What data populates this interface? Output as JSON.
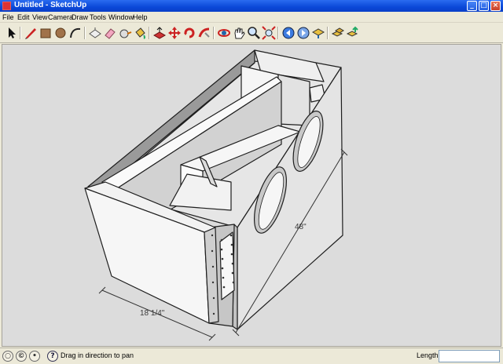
{
  "window": {
    "title": "Untitled - SketchUp",
    "minimize_glyph": "_",
    "maximize_glyph": "□",
    "close_glyph": "×"
  },
  "menu": [
    "File",
    "Edit",
    "View",
    "Camera",
    "Draw",
    "Tools",
    "Window",
    "Help"
  ],
  "toolbar": {
    "tools": [
      {
        "name": "select-tool"
      },
      {
        "name": "pencil-line-tool"
      },
      {
        "name": "rectangle-tool"
      },
      {
        "name": "circle-tool"
      },
      {
        "name": "arc-tool"
      },
      {
        "name": "make-component-tool"
      },
      {
        "name": "eraser-tool"
      },
      {
        "name": "tape-measure-tool"
      },
      {
        "name": "paint-bucket-tool"
      },
      {
        "name": "push-pull-tool"
      },
      {
        "name": "move-tool"
      },
      {
        "name": "rotate-tool"
      },
      {
        "name": "follow-me-tool"
      },
      {
        "name": "orbit-tool"
      },
      {
        "name": "pan-tool"
      },
      {
        "name": "zoom-tool"
      },
      {
        "name": "zoom-extents-tool"
      },
      {
        "name": "previous-view-tool"
      },
      {
        "name": "next-view-tool"
      },
      {
        "name": "get-models-tool"
      },
      {
        "name": "component-browser-tool"
      },
      {
        "name": "share-model-tool"
      }
    ]
  },
  "viewport": {
    "background": "#dcdcdc",
    "dimensions": {
      "length": "48\"",
      "width": "18 1/4\""
    }
  },
  "status": {
    "message": "Drag in direction to pan",
    "vcb_label": "Length",
    "vcb_value": "",
    "icons": [
      "geo-location-icon",
      "credits-icon",
      "user-icon",
      "help-icon"
    ]
  },
  "colors": {
    "titlebar": "#0a48d8",
    "chrome": "#ece9d8",
    "face_light": "#f4f4f4",
    "face_shade": "#c8c8c8",
    "edge": "#202020"
  }
}
